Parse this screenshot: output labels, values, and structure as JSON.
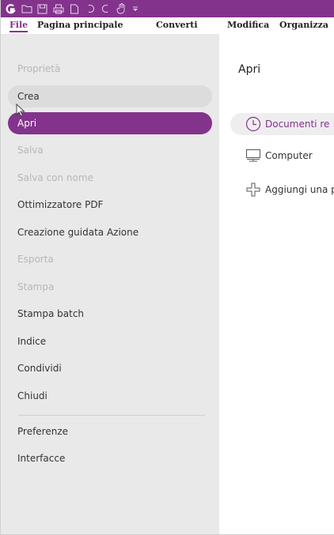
{
  "quick_access": {
    "icons": [
      "app-logo-icon",
      "open-folder-icon",
      "save-icon",
      "print-icon",
      "new-document-icon",
      "undo-icon",
      "redo-icon",
      "hand-tool-icon",
      "customize-dropdown-icon"
    ]
  },
  "tabs": [
    {
      "label": "File",
      "active": true
    },
    {
      "label": "Pagina principale"
    },
    {
      "label": "Converti"
    },
    {
      "label": "Modifica"
    },
    {
      "label": "Organizza"
    }
  ],
  "menu": {
    "items": [
      {
        "label": "Proprietà",
        "state": "disabled"
      },
      {
        "label": "Crea",
        "state": "hover"
      },
      {
        "label": "Apri",
        "state": "selected"
      },
      {
        "label": "Salva",
        "state": "disabled"
      },
      {
        "label": "Salva con nome",
        "state": "disabled"
      },
      {
        "label": "Ottimizzatore PDF",
        "state": "normal"
      },
      {
        "label": "Creazione guidata Azione",
        "state": "normal"
      },
      {
        "label": "Esporta",
        "state": "disabled"
      },
      {
        "label": "Stampa",
        "state": "disabled"
      },
      {
        "label": "Stampa batch",
        "state": "normal"
      },
      {
        "label": "Indice",
        "state": "normal"
      },
      {
        "label": "Condividi",
        "state": "normal"
      },
      {
        "label": "Chiudi",
        "state": "normal"
      },
      {
        "label": "Preferenze",
        "state": "normal"
      },
      {
        "label": "Interfacce",
        "state": "normal"
      }
    ]
  },
  "open_panel": {
    "title": "Apri",
    "items": [
      {
        "label": "Documenti re",
        "icon": "clock-icon",
        "active": true
      },
      {
        "label": "Computer",
        "icon": "computer-icon"
      },
      {
        "label": "Aggiungi una p",
        "icon": "add-place-icon"
      }
    ]
  },
  "colors": {
    "accent": "#83338c",
    "sidebar_bg": "#e9e9e9",
    "disabled_text": "#b7b7b7"
  }
}
